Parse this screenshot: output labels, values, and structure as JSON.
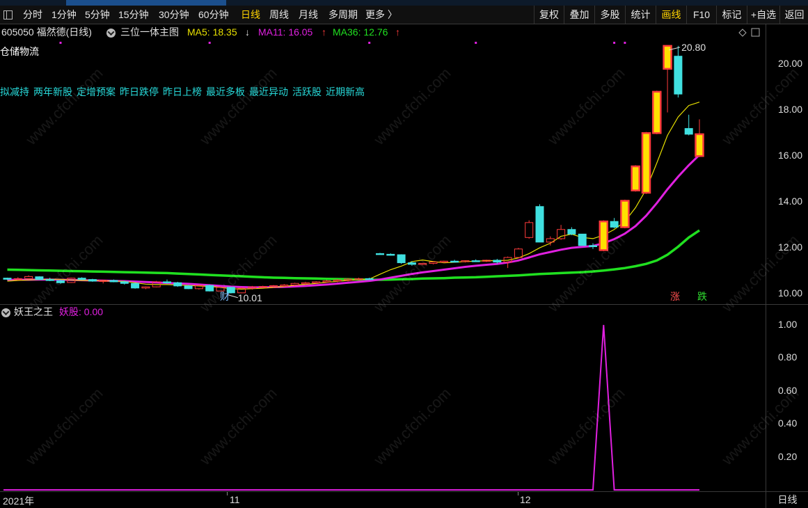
{
  "toolbar": {
    "periods": [
      "分时",
      "1分钟",
      "5分钟",
      "15分钟",
      "30分钟",
      "60分钟",
      "日线",
      "周线",
      "月线",
      "多周期",
      "更多 〉"
    ],
    "active_period": "日线",
    "right_buttons": [
      "复权",
      "叠加",
      "多股",
      "统计",
      "画线",
      "F10",
      "标记",
      "+自选",
      "返回"
    ],
    "highlight_button": "画线"
  },
  "info": {
    "code_name": "605050 福然德(日线)",
    "template": "三位一体主图",
    "ma5_label": "MA5: 18.35",
    "ma5_arrow": "↓",
    "ma11_label": "MA11: 16.05",
    "ma11_arrow": "↑",
    "ma36_label": "MA36: 12.76",
    "ma36_arrow": "↑"
  },
  "sector": "仓储物流",
  "tags": [
    "拟减持",
    "两年新股",
    "定增预案",
    "昨日跌停",
    "昨日上榜",
    "最近多板",
    "最近异动",
    "活跃股",
    "近期新高"
  ],
  "markers": {
    "high_label": "20.80",
    "low_label": "10.01",
    "cai": "财",
    "zhang": "涨",
    "die": "跌"
  },
  "indicator": {
    "name": "妖王之王",
    "value_label": "妖股: 0.00"
  },
  "bottom": {
    "year_label": "2021年",
    "month1": "11",
    "month2": "12",
    "period": "日线"
  },
  "watermark": "www.cfchi.com",
  "colors": {
    "up": "#ff3b3b",
    "down": "#40e0e0",
    "ma5": "#e8e000",
    "ma11": "#e020e0",
    "ma36": "#20e020",
    "accent": "#ffd400",
    "tag": "#27d9d9"
  },
  "chart_data": [
    {
      "type": "candlestick",
      "title": "605050 福然德(日线)",
      "ylim": [
        9.7,
        21.1
      ],
      "yticks": [
        10.0,
        12.0,
        14.0,
        16.0,
        18.0,
        20.0
      ],
      "series_ohlc": [
        [
          10.68,
          10.7,
          10.6,
          10.63
        ],
        [
          10.64,
          10.72,
          10.58,
          10.66
        ],
        [
          10.66,
          10.8,
          10.63,
          10.75
        ],
        [
          10.74,
          10.76,
          10.6,
          10.62
        ],
        [
          10.62,
          10.7,
          10.55,
          10.6
        ],
        [
          10.57,
          10.62,
          10.44,
          10.48
        ],
        [
          10.49,
          10.7,
          10.47,
          10.68
        ],
        [
          10.68,
          10.72,
          10.6,
          10.62
        ],
        [
          10.62,
          10.65,
          10.52,
          10.55
        ],
        [
          10.54,
          10.6,
          10.45,
          10.58
        ],
        [
          10.58,
          10.62,
          10.5,
          10.52
        ],
        [
          10.52,
          10.56,
          10.4,
          10.45
        ],
        [
          10.45,
          10.48,
          10.22,
          10.25
        ],
        [
          10.25,
          10.32,
          10.2,
          10.3
        ],
        [
          10.3,
          10.56,
          10.28,
          10.52
        ],
        [
          10.52,
          10.62,
          10.44,
          10.48
        ],
        [
          10.48,
          10.52,
          10.3,
          10.34
        ],
        [
          10.34,
          10.38,
          10.2,
          10.22
        ],
        [
          10.22,
          10.4,
          10.18,
          10.36
        ],
        [
          10.36,
          10.4,
          10.1,
          10.12
        ],
        [
          10.12,
          10.32,
          10.1,
          10.28
        ],
        [
          10.28,
          10.3,
          10.01,
          10.04
        ],
        [
          10.04,
          10.28,
          10.02,
          10.24
        ],
        [
          10.24,
          10.34,
          10.18,
          10.3
        ],
        [
          10.3,
          10.35,
          10.25,
          10.32
        ],
        [
          10.32,
          10.38,
          10.27,
          10.35
        ],
        [
          10.35,
          10.42,
          10.3,
          10.38
        ],
        [
          10.38,
          10.48,
          10.34,
          10.45
        ],
        [
          10.45,
          10.52,
          10.4,
          10.48
        ],
        [
          10.48,
          10.55,
          10.44,
          10.52
        ],
        [
          10.52,
          10.6,
          10.48,
          10.56
        ],
        [
          10.56,
          10.64,
          10.5,
          10.6
        ],
        [
          10.6,
          10.68,
          10.54,
          10.64
        ],
        [
          10.64,
          10.7,
          10.58,
          10.66
        ],
        [
          10.66,
          10.7,
          10.6,
          10.62
        ],
        [
          11.75,
          11.78,
          11.7,
          11.72
        ],
        [
          11.72,
          11.76,
          11.66,
          11.7
        ],
        [
          11.7,
          11.72,
          11.3,
          11.35
        ],
        [
          11.35,
          11.42,
          11.22,
          11.28
        ],
        [
          11.28,
          11.34,
          11.25,
          11.32
        ],
        [
          11.32,
          11.4,
          11.28,
          11.38
        ],
        [
          11.38,
          11.44,
          11.34,
          11.42
        ],
        [
          11.42,
          11.48,
          11.36,
          11.4
        ],
        [
          11.4,
          11.46,
          11.36,
          11.44
        ],
        [
          11.44,
          11.5,
          11.4,
          11.42
        ],
        [
          11.42,
          11.48,
          11.38,
          11.46
        ],
        [
          11.46,
          11.52,
          11.3,
          11.38
        ],
        [
          11.38,
          11.62,
          11.12,
          11.58
        ],
        [
          11.58,
          12.0,
          11.56,
          11.95
        ],
        [
          12.45,
          13.2,
          12.4,
          13.1
        ],
        [
          13.8,
          13.9,
          12.4,
          12.25
        ],
        [
          12.25,
          12.5,
          12.1,
          12.4
        ],
        [
          12.4,
          13.0,
          12.35,
          12.8
        ],
        [
          12.8,
          12.9,
          12.55,
          12.6
        ],
        [
          12.6,
          12.6,
          12.1,
          12.1
        ],
        [
          12.1,
          12.2,
          11.95,
          12.05
        ],
        [
          11.9,
          13.2,
          11.85,
          13.15
        ],
        [
          13.15,
          13.3,
          12.85,
          12.9
        ],
        [
          12.9,
          14.1,
          12.85,
          14.05
        ],
        [
          14.5,
          15.6,
          14.45,
          15.55
        ],
        [
          14.4,
          17.05,
          14.35,
          17.0
        ],
        [
          17.0,
          18.85,
          16.95,
          18.8
        ],
        [
          19.8,
          20.8,
          17.9,
          20.8
        ],
        [
          20.35,
          20.8,
          18.55,
          18.7
        ],
        [
          17.2,
          17.8,
          16.9,
          16.95
        ],
        [
          16.0,
          17.6,
          15.95,
          16.95
        ]
      ],
      "ma5": [
        10.55,
        10.58,
        10.6,
        10.62,
        10.63,
        10.63,
        10.6,
        10.58,
        10.58,
        10.57,
        10.55,
        10.54,
        10.48,
        10.42,
        10.4,
        10.4,
        10.38,
        10.36,
        10.34,
        10.32,
        10.28,
        10.22,
        10.2,
        10.22,
        10.24,
        10.28,
        10.32,
        10.37,
        10.41,
        10.45,
        10.5,
        10.54,
        10.58,
        10.62,
        10.64,
        10.85,
        11.05,
        11.2,
        11.4,
        11.47,
        11.4,
        11.35,
        11.37,
        11.4,
        11.42,
        11.44,
        11.44,
        11.46,
        11.56,
        11.75,
        12.0,
        12.2,
        12.5,
        12.6,
        12.45,
        12.4,
        12.55,
        12.8,
        13.15,
        13.75,
        14.55,
        15.7,
        16.9,
        17.7,
        18.2,
        18.35
      ],
      "ma11": [
        10.6,
        10.61,
        10.61,
        10.62,
        10.62,
        10.61,
        10.6,
        10.59,
        10.58,
        10.57,
        10.56,
        10.55,
        10.53,
        10.51,
        10.49,
        10.47,
        10.45,
        10.43,
        10.4,
        10.37,
        10.34,
        10.31,
        10.29,
        10.28,
        10.28,
        10.29,
        10.3,
        10.32,
        10.34,
        10.37,
        10.4,
        10.44,
        10.48,
        10.52,
        10.56,
        10.62,
        10.7,
        10.78,
        10.86,
        10.93,
        10.99,
        11.05,
        11.11,
        11.17,
        11.22,
        11.26,
        11.3,
        11.36,
        11.45,
        11.58,
        11.72,
        11.82,
        11.92,
        12.0,
        12.04,
        12.08,
        12.2,
        12.38,
        12.62,
        12.95,
        13.4,
        13.95,
        14.55,
        15.1,
        15.6,
        16.05
      ],
      "ma36": [
        11.05,
        11.04,
        11.03,
        11.02,
        11.01,
        11.0,
        10.99,
        10.98,
        10.97,
        10.96,
        10.95,
        10.94,
        10.93,
        10.92,
        10.91,
        10.9,
        10.88,
        10.86,
        10.84,
        10.82,
        10.8,
        10.78,
        10.76,
        10.74,
        10.72,
        10.7,
        10.69,
        10.68,
        10.67,
        10.66,
        10.65,
        10.64,
        10.63,
        10.62,
        10.61,
        10.61,
        10.62,
        10.63,
        10.64,
        10.66,
        10.67,
        10.68,
        10.7,
        10.71,
        10.72,
        10.74,
        10.76,
        10.78,
        10.8,
        10.83,
        10.86,
        10.88,
        10.9,
        10.92,
        10.94,
        10.97,
        11.01,
        11.06,
        11.12,
        11.2,
        11.3,
        11.45,
        11.7,
        12.05,
        12.45,
        12.76
      ]
    },
    {
      "type": "line",
      "title": "妖王之王",
      "ylim": [
        0,
        1.05
      ],
      "yticks": [
        0.2,
        0.4,
        0.6,
        0.8,
        1.0
      ],
      "series": [
        {
          "name": "妖股",
          "values": [
            0,
            0,
            0,
            0,
            0,
            0,
            0,
            0,
            0,
            0,
            0,
            0,
            0,
            0,
            0,
            0,
            0,
            0,
            0,
            0,
            0,
            0,
            0,
            0,
            0,
            0,
            0,
            0,
            0,
            0,
            0,
            0,
            0,
            0,
            0,
            0,
            0,
            0,
            0,
            0,
            0,
            0,
            0,
            0,
            0,
            0,
            0,
            0,
            0,
            0,
            0,
            0,
            0,
            0,
            0,
            0,
            1,
            0,
            0,
            0,
            0,
            0,
            0,
            0,
            0,
            0
          ]
        }
      ]
    }
  ]
}
